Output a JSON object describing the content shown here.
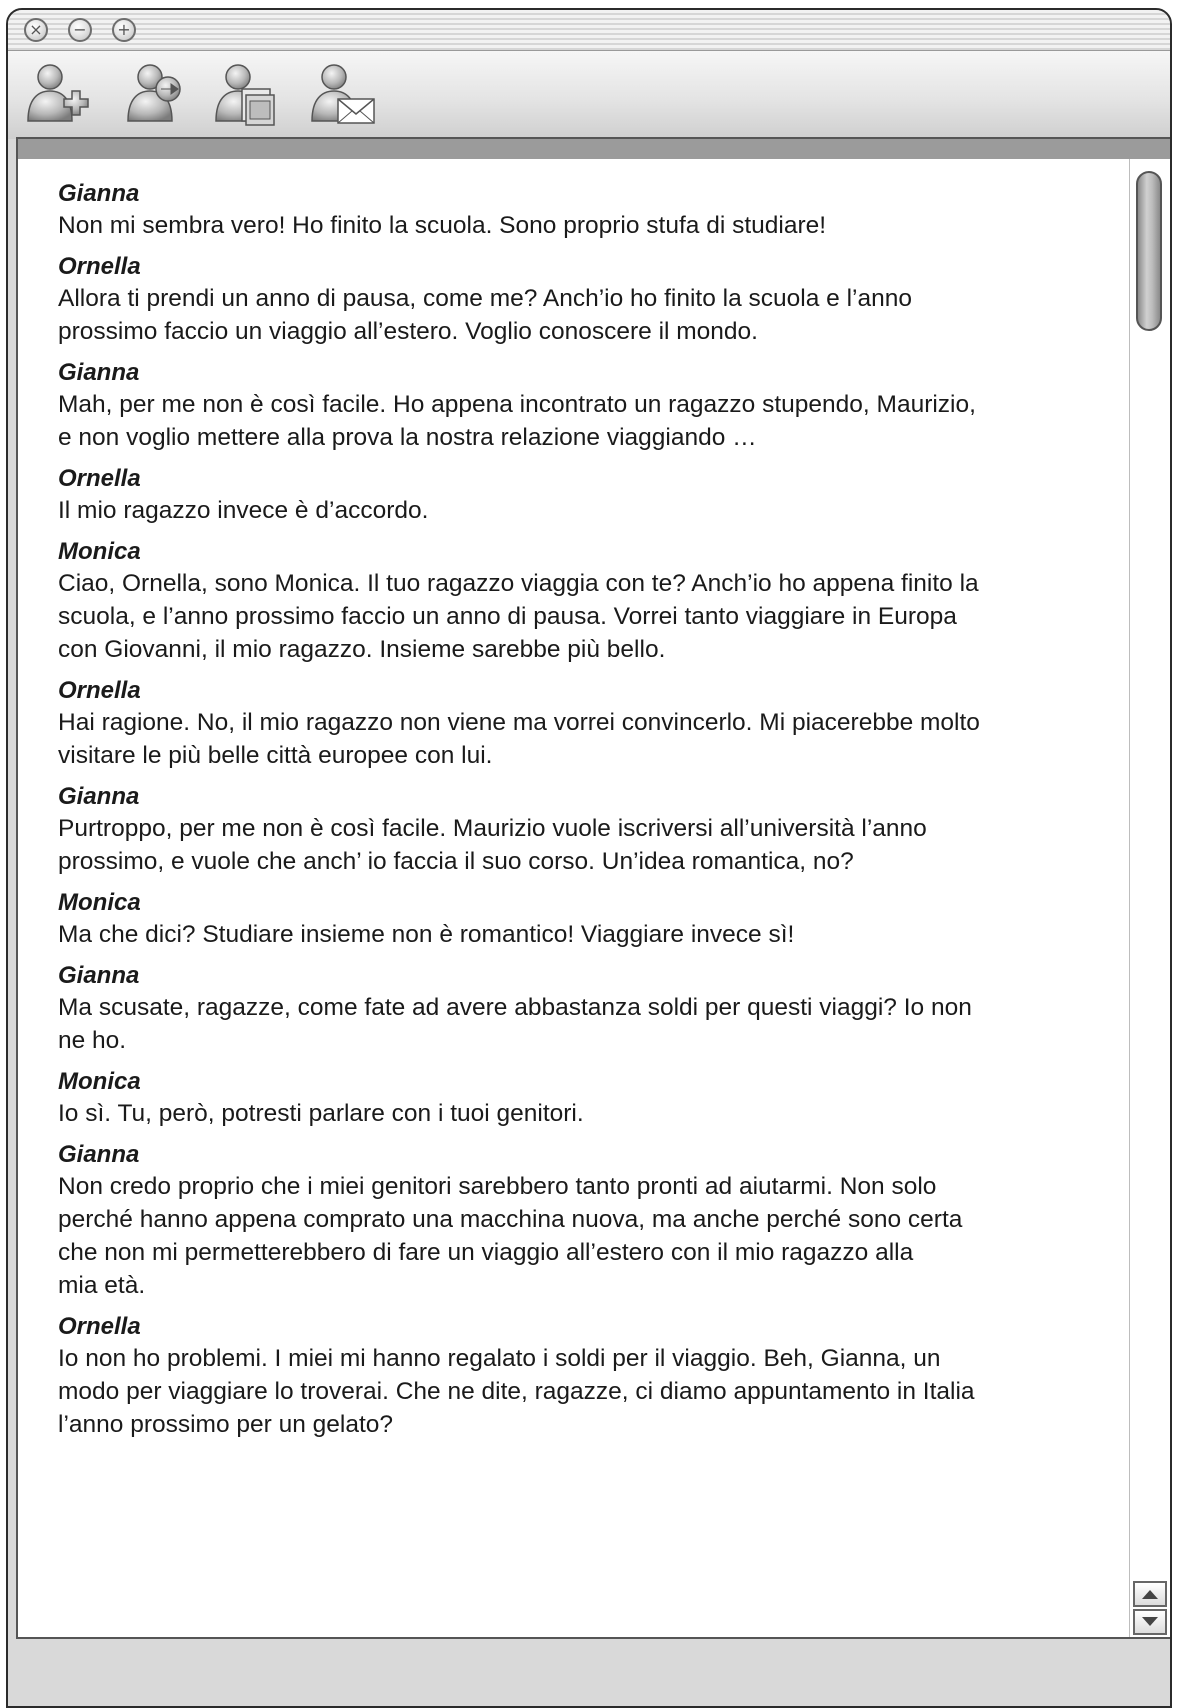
{
  "window": {
    "controls": [
      {
        "name": "close",
        "glyph": "×"
      },
      {
        "name": "minimize",
        "glyph": "−"
      },
      {
        "name": "zoom",
        "glyph": "+"
      }
    ]
  },
  "toolbar": {
    "buttons": [
      {
        "icon": "add-contact-icon"
      },
      {
        "icon": "send-to-contact-icon"
      },
      {
        "icon": "share-screen-contact-icon"
      },
      {
        "icon": "email-contact-icon"
      }
    ]
  },
  "chat": {
    "messages": [
      {
        "speaker": "Gianna",
        "lines": [
          "Non mi sembra vero! Ho finito la scuola. Sono proprio stufa di studiare!"
        ]
      },
      {
        "speaker": "Ornella",
        "lines": [
          "Allora ti prendi un anno di pausa, come me? Anch’io ho finito la scuola e l’anno",
          "prossimo faccio un viaggio all’estero. Voglio conoscere il mondo."
        ]
      },
      {
        "speaker": "Gianna",
        "lines": [
          "Mah, per me non è così facile. Ho appena incontrato un ragazzo stupendo, Maurizio,",
          "e non voglio mettere alla prova la nostra relazione viaggiando …"
        ]
      },
      {
        "speaker": "Ornella",
        "lines": [
          "Il mio ragazzo invece è d’accordo."
        ]
      },
      {
        "speaker": "Monica",
        "lines": [
          "Ciao, Ornella, sono Monica. Il tuo ragazzo viaggia con te? Anch’io ho appena finito la",
          "scuola, e l’anno prossimo faccio un anno di pausa. Vorrei tanto viaggiare in Europa",
          "con Giovanni, il mio ragazzo. Insieme sarebbe più bello."
        ]
      },
      {
        "speaker": "Ornella",
        "lines": [
          "Hai ragione. No, il mio ragazzo non viene ma vorrei convincerlo. Mi piacerebbe molto",
          "visitare le più belle città europee con lui."
        ]
      },
      {
        "speaker": "Gianna",
        "lines": [
          "Purtroppo, per me non è così facile. Maurizio vuole iscriversi all’università l’anno",
          "prossimo, e vuole che anch’ io faccia il suo corso. Un’idea romantica, no?"
        ]
      },
      {
        "speaker": "Monica",
        "lines": [
          "Ma che dici? Studiare insieme non è romantico! Viaggiare invece sì!"
        ]
      },
      {
        "speaker": "Gianna",
        "lines": [
          "Ma scusate, ragazze, come fate ad avere abbastanza soldi per questi viaggi? Io non",
          "ne ho."
        ]
      },
      {
        "speaker": "Monica",
        "lines": [
          "Io sì. Tu, però, potresti parlare con i tuoi genitori."
        ]
      },
      {
        "speaker": "Gianna",
        "lines": [
          "Non credo proprio che i miei genitori sarebbero tanto pronti ad aiutarmi. Non solo",
          "perché hanno appena comprato una macchina nuova, ma anche perché sono certa",
          "che non mi permetterebbero di fare un viaggio all’estero con il mio ragazzo alla",
          "mia età."
        ]
      },
      {
        "speaker": "Ornella",
        "lines": [
          "Io non ho problemi. I miei mi hanno regalato i soldi per il viaggio. Beh, Gianna, un",
          "modo per viaggiare lo troverai. Che ne dite, ragazze, ci diamo appuntamento in Italia",
          "l’anno prossimo per un gelato?"
        ]
      }
    ]
  },
  "scrollbar": {
    "up_icon": "arrow-up-icon",
    "down_icon": "arrow-down-icon"
  }
}
